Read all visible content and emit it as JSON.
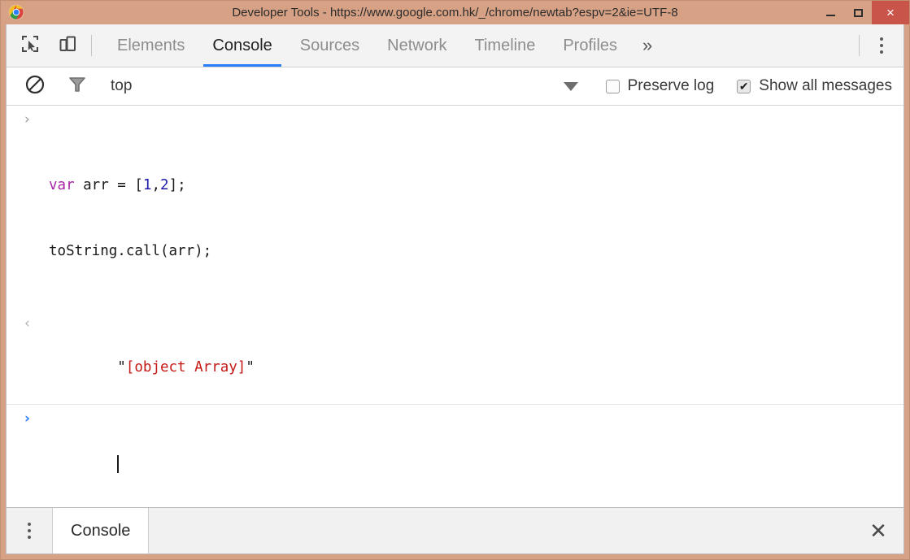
{
  "window": {
    "title": "Developer Tools - https://www.google.com.hk/_/chrome/newtab?espv=2&ie=UTF-8",
    "app_icon": "chrome-logo-icon",
    "controls": {
      "minimize": "minimize-icon",
      "maximize": "maximize-icon",
      "close": "×"
    },
    "frame_color": "#d6a184",
    "close_button_color": "#c9544a"
  },
  "tabstrip": {
    "inspect_icon": "inspect-element-icon",
    "device_icon": "device-toolbar-icon",
    "tabs": [
      {
        "label": "Elements",
        "active": false
      },
      {
        "label": "Console",
        "active": true
      },
      {
        "label": "Sources",
        "active": false
      },
      {
        "label": "Network",
        "active": false
      },
      {
        "label": "Timeline",
        "active": false
      },
      {
        "label": "Profiles",
        "active": false
      }
    ],
    "overflow": "»",
    "menu_icon": "more-vertical-icon",
    "active_underline_color": "#2d7ff9"
  },
  "console_toolbar": {
    "clear_icon": "clear-console-icon",
    "filter_icon": "filter-icon",
    "context": "top",
    "caret_icon": "chevron-down-icon",
    "preserve_log": {
      "label": "Preserve log",
      "checked": false
    },
    "show_all_messages": {
      "label": "Show all messages",
      "checked": true,
      "mark": "✔"
    }
  },
  "console": {
    "rows": [
      {
        "type": "input",
        "gutter": "›",
        "line1": {
          "keyword": "var",
          "mid": " arr = ",
          "bracket_open": "[",
          "num1": "1",
          "comma": ",",
          "num2": "2",
          "bracket_close": "]",
          "semi": ";"
        },
        "line2": "toString.call(arr);"
      },
      {
        "type": "output",
        "gutter": "‹",
        "quote_open": "\"",
        "value": "[object Array]",
        "quote_close": "\""
      },
      {
        "type": "prompt",
        "gutter": "›",
        "value": ""
      }
    ]
  },
  "drawer": {
    "menu_icon": "more-vertical-icon",
    "tab_label": "Console",
    "close_icon": "✕"
  }
}
